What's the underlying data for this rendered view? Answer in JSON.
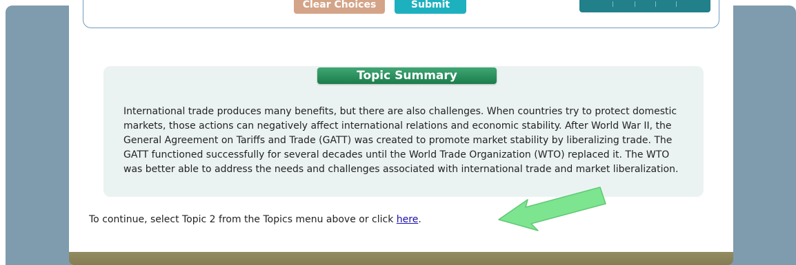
{
  "toolbar": {
    "clear_label": "Clear Choices",
    "submit_label": "Submit"
  },
  "summary": {
    "title": "Topic Summary",
    "body": "International trade produces many benefits, but there are also challenges. When countries try to protect domestic markets, those actions can negatively affect international relations and economic stability. After World War II, the General Agreement on Tariffs and Trade (GATT) was created to promote market stability by liberalizing trade. The GATT functioned successfully for several decades until the World Trade Organization (WTO) replaced it. The WTO was better able to address the needs and challenges associated with international trade and market liberalization."
  },
  "continue": {
    "text_before": "To continue, select Topic 2 from the Topics menu above or click ",
    "link_label": "here",
    "text_after": "."
  },
  "colors": {
    "background": "#7f9bae",
    "panel": "#ffffff",
    "summary_box": "#ebf3f2",
    "title_bar": "#1b7d4c",
    "clear_button": "#d4a488",
    "submit_button": "#1db1bf",
    "nav_toolbar": "#218089",
    "arrow": "#7de58f",
    "link": "#1a0dab"
  },
  "icons": {
    "pointer": "arrow-pointer-icon"
  }
}
